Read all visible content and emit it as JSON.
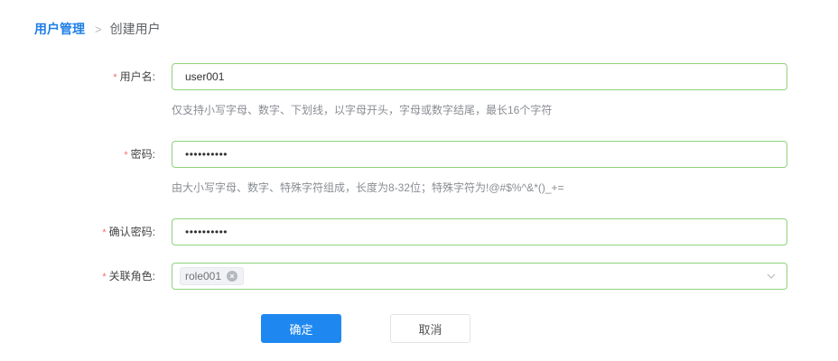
{
  "breadcrumb": {
    "root": "用户管理",
    "separator": ">",
    "current": "创建用户"
  },
  "form": {
    "required_mark": "*",
    "username": {
      "label": "用户名:",
      "value": "user001",
      "hint": "仅支持小写字母、数字、下划线，以字母开头，字母或数字结尾，最长16个字符"
    },
    "password": {
      "label": "密码:",
      "value_masked": "••••••••••",
      "hint": "由大小写字母、数字、特殊字符组成，长度为8-32位；特殊字符为!@#$%^&*()_+="
    },
    "confirm_password": {
      "label": "确认密码:",
      "value_masked": "••••••••••"
    },
    "role": {
      "label": "关联角色:",
      "selected_tags": [
        "role001"
      ]
    }
  },
  "actions": {
    "confirm_label": "确定",
    "cancel_label": "取消"
  },
  "colors": {
    "accent": "#1e88f0",
    "valid_border": "#8fd27b",
    "required": "#f56c6c"
  },
  "icons": {
    "separator": "chevron-right-icon",
    "tag_remove": "close-circle-icon",
    "select_toggle": "chevron-down-icon"
  }
}
